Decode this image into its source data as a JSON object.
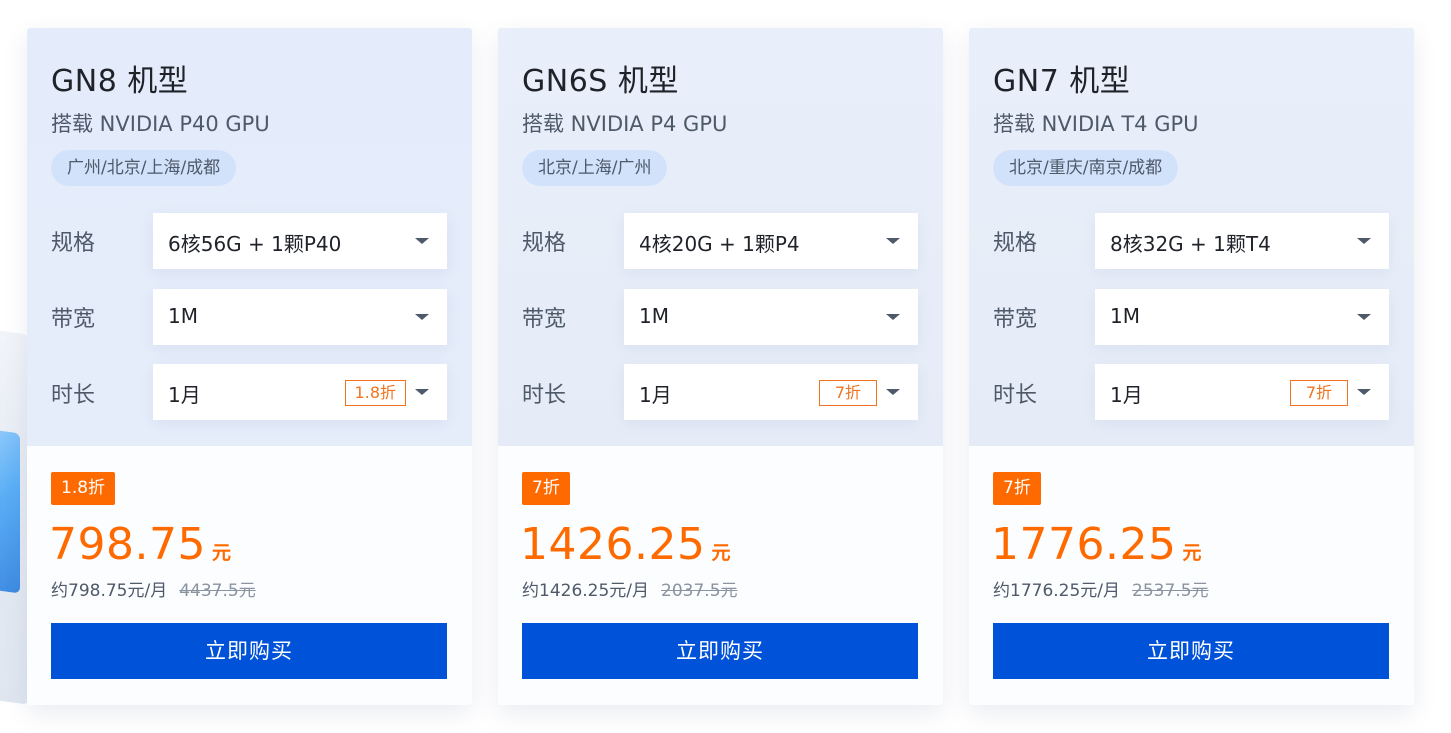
{
  "colors": {
    "accent": "#0052d9",
    "discount": "#ff6a00",
    "card_top_bg": "#e6ecf7"
  },
  "labels": {
    "spec": "规格",
    "bandwidth": "带宽",
    "duration": "时长",
    "buy": "立即购买",
    "caret_icon": "chevron-down-icon"
  },
  "cards": [
    {
      "title": "GN8 机型",
      "subtitle": "搭载 NVIDIA P40 GPU",
      "regions": "广州/北京/上海/成都",
      "spec_value": "6核56G + 1颗P40",
      "bandwidth_value": "1M",
      "duration_value": "1月",
      "duration_discount": "1.8折",
      "badge": "1.8折",
      "price": "798.75",
      "price_unit": "元",
      "monthly": "约798.75元/月",
      "original_price": "4437.5元"
    },
    {
      "title": "GN6S 机型",
      "subtitle": "搭载 NVIDIA P4 GPU",
      "regions": "北京/上海/广州",
      "spec_value": "4核20G + 1颗P4",
      "bandwidth_value": "1M",
      "duration_value": "1月",
      "duration_discount": "7折",
      "badge": "7折",
      "price": "1426.25",
      "price_unit": "元",
      "monthly": "约1426.25元/月",
      "original_price": "2037.5元"
    },
    {
      "title": "GN7 机型",
      "subtitle": "搭载 NVIDIA T4 GPU",
      "regions": "北京/重庆/南京/成都",
      "spec_value": "8核32G + 1颗T4",
      "bandwidth_value": "1M",
      "duration_value": "1月",
      "duration_discount": "7折",
      "badge": "7折",
      "price": "1776.25",
      "price_unit": "元",
      "monthly": "约1776.25元/月",
      "original_price": "2537.5元"
    }
  ]
}
